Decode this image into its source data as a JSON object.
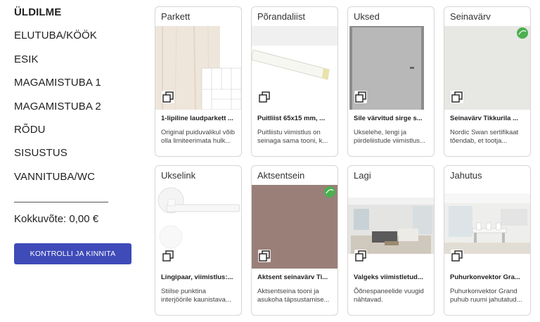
{
  "sidebar": {
    "items": [
      {
        "label": "ÜLDILME",
        "active": true
      },
      {
        "label": "ELUTUBA/KÖÖK",
        "active": false
      },
      {
        "label": "ESIK",
        "active": false
      },
      {
        "label": "MAGAMISTUBA 1",
        "active": false
      },
      {
        "label": "MAGAMISTUBA 2",
        "active": false
      },
      {
        "label": "RÕDU",
        "active": false
      },
      {
        "label": "SISUSTUS",
        "active": false
      },
      {
        "label": "VANNITUBA/WC",
        "active": false
      }
    ],
    "total_label": "Kokkuvõte: 0,00 €",
    "confirm_button": "KONTROLLI JA KINNITA"
  },
  "colors": {
    "accent": "#3e4bb8",
    "eco_badge": "#4caf50"
  },
  "cards": [
    {
      "category": "Parkett",
      "name": "1-lipiline laudparkett ...",
      "desc": "Original puiduvalikul võib olla limiteerimata hulk...",
      "icon": "stack-icon"
    },
    {
      "category": "Põrandaliist",
      "name": "Puitliist 65x15 mm, ...",
      "desc": "Puitliistu viimistlus on seinaga sama tooni, k...",
      "icon": "stack-icon"
    },
    {
      "category": "Uksed",
      "name": "Sile värvitud sirge s...",
      "desc": "Ukselehe, lengi ja piirdeliistude viimistlus...",
      "icon": "stack-icon"
    },
    {
      "category": "Seinavärv",
      "name": "Seinavärv Tikkurila ...",
      "desc": "Nordic Swan sertifikaat tõendab, et tootja...",
      "icon": "stack-icon"
    },
    {
      "category": "Ukselink",
      "name": "Lingipaar, viimistlus:...",
      "desc": "Stiilse punktina interjöörile kaunistava...",
      "icon": "stack-icon"
    },
    {
      "category": "Aktsentsein",
      "name": "Aktsent seinavärv Ti...",
      "desc": "Aktsentseina tooni ja asukoha täpsustamise...",
      "icon": "stack-icon"
    },
    {
      "category": "Lagi",
      "name": "Valgeks viimistletud...",
      "desc": "Õõnespaneelide vuugid nähtavad.",
      "icon": "stack-icon"
    },
    {
      "category": "Jahutus",
      "name": "Puhurkonvektor Gra...",
      "desc": "Puhurkonvektor Grand puhub ruumi jahutatud...",
      "icon": "stack-icon"
    }
  ]
}
